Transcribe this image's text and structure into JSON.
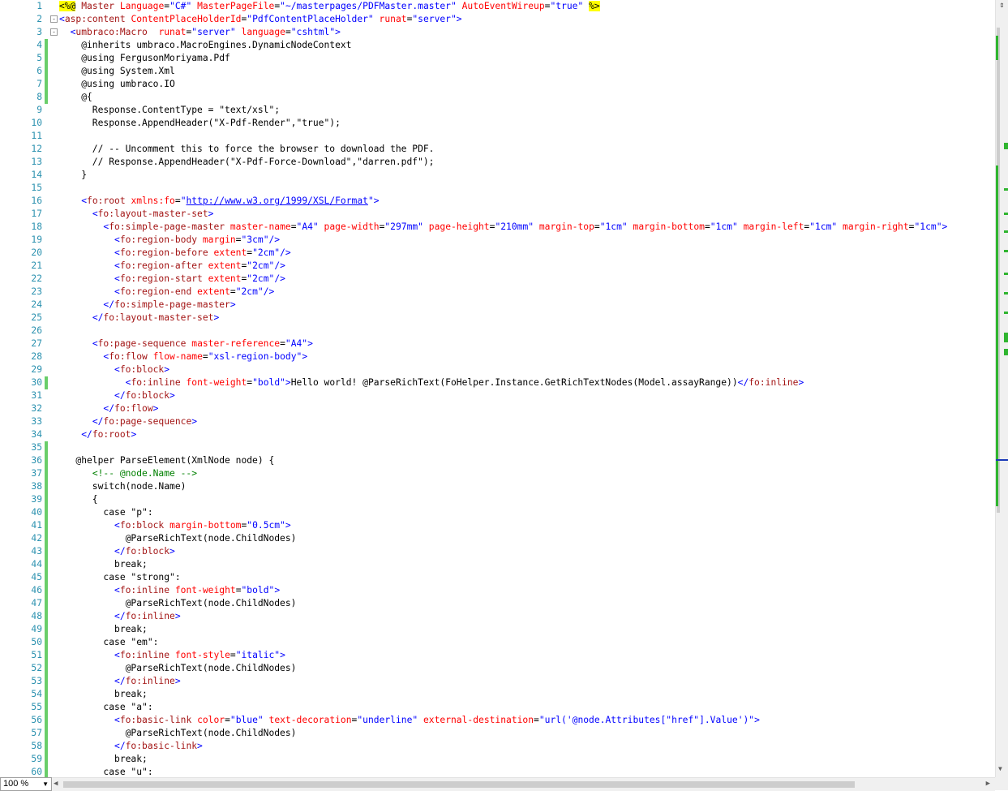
{
  "editor": {
    "lines": [
      {
        "n": "1",
        "html": "<span class=\"hl\">&lt;%@</span> <span class=\"t\">Master</span> <span class=\"a\">Language</span>=<span class=\"v\">\"C#\"</span> <span class=\"a\">MasterPageFile</span>=<span class=\"v\">\"~/masterpages/PDFMaster.master\"</span> <span class=\"a\">AutoEventWireup</span>=<span class=\"v\">\"true\"</span> <span class=\"hl\">%&gt;</span>"
      },
      {
        "n": "2",
        "html": "<span class=\"p\">&lt;</span><span class=\"t\">asp:content</span> <span class=\"a\">ContentPlaceHolderId</span>=<span class=\"v\">\"PdfContentPlaceHolder\"</span> <span class=\"a\">runat</span>=<span class=\"v\">\"server\"</span><span class=\"p\">&gt;</span>",
        "fold": "-"
      },
      {
        "n": "3",
        "html": "  <span class=\"p\">&lt;</span><span class=\"t\">umbraco:Macro</span>  <span class=\"a\">runat</span>=<span class=\"v\">\"server\"</span> <span class=\"a\">language</span>=<span class=\"v\">\"cshtml\"</span><span class=\"p\">&gt;</span>",
        "fold": "-"
      },
      {
        "n": "4",
        "html": "    @inherits umbraco.MacroEngines.DynamicNodeContext",
        "chg": true
      },
      {
        "n": "5",
        "html": "    @using FergusonMoriyama.Pdf",
        "chg": true
      },
      {
        "n": "6",
        "html": "    @using System.Xml",
        "chg": true
      },
      {
        "n": "7",
        "html": "    @using umbraco.IO",
        "chg": true
      },
      {
        "n": "8",
        "html": "    @{",
        "chg": true
      },
      {
        "n": "9",
        "html": "      Response.ContentType = \"text/xsl\";"
      },
      {
        "n": "10",
        "html": "      Response.AppendHeader(\"X-Pdf-Render\",\"true\");"
      },
      {
        "n": "11",
        "html": ""
      },
      {
        "n": "12",
        "html": "      // -- Uncomment this to force the browser to download the PDF."
      },
      {
        "n": "13",
        "html": "      // Response.AppendHeader(\"X-Pdf-Force-Download\",\"darren.pdf\");"
      },
      {
        "n": "14",
        "html": "    }"
      },
      {
        "n": "15",
        "html": ""
      },
      {
        "n": "16",
        "html": "    <span class=\"p\">&lt;</span><span class=\"t\">fo:root</span> <span class=\"a\">xmlns:fo</span>=<span class=\"v\">\"</span><span class=\"u\">http://www.w3.org/1999/XSL/Format</span><span class=\"v\">\"</span><span class=\"p\">&gt;</span>"
      },
      {
        "n": "17",
        "html": "      <span class=\"p\">&lt;</span><span class=\"t\">fo:layout-master-set</span><span class=\"p\">&gt;</span>"
      },
      {
        "n": "18",
        "html": "        <span class=\"p\">&lt;</span><span class=\"t\">fo:simple-page-master</span> <span class=\"a\">master-name</span>=<span class=\"v\">\"A4\"</span> <span class=\"a\">page-width</span>=<span class=\"v\">\"297mm\"</span> <span class=\"a\">page-height</span>=<span class=\"v\">\"210mm\"</span> <span class=\"a\">margin-top</span>=<span class=\"v\">\"1cm\"</span> <span class=\"a\">margin-bottom</span>=<span class=\"v\">\"1cm\"</span> <span class=\"a\">margin-left</span>=<span class=\"v\">\"1cm\"</span> <span class=\"a\">margin-right</span>=<span class=\"v\">\"1cm\"</span><span class=\"p\">&gt;</span>"
      },
      {
        "n": "19",
        "html": "          <span class=\"p\">&lt;</span><span class=\"t\">fo:region-body</span> <span class=\"a\">margin</span>=<span class=\"v\">\"3cm\"</span><span class=\"p\">/&gt;</span>"
      },
      {
        "n": "20",
        "html": "          <span class=\"p\">&lt;</span><span class=\"t\">fo:region-before</span> <span class=\"a\">extent</span>=<span class=\"v\">\"2cm\"</span><span class=\"p\">/&gt;</span>"
      },
      {
        "n": "21",
        "html": "          <span class=\"p\">&lt;</span><span class=\"t\">fo:region-after</span> <span class=\"a\">extent</span>=<span class=\"v\">\"2cm\"</span><span class=\"p\">/&gt;</span>"
      },
      {
        "n": "22",
        "html": "          <span class=\"p\">&lt;</span><span class=\"t\">fo:region-start</span> <span class=\"a\">extent</span>=<span class=\"v\">\"2cm\"</span><span class=\"p\">/&gt;</span>"
      },
      {
        "n": "23",
        "html": "          <span class=\"p\">&lt;</span><span class=\"t\">fo:region-end</span> <span class=\"a\">extent</span>=<span class=\"v\">\"2cm\"</span><span class=\"p\">/&gt;</span>"
      },
      {
        "n": "24",
        "html": "        <span class=\"p\">&lt;/</span><span class=\"t\">fo:simple-page-master</span><span class=\"p\">&gt;</span>"
      },
      {
        "n": "25",
        "html": "      <span class=\"p\">&lt;/</span><span class=\"t\">fo:layout-master-set</span><span class=\"p\">&gt;</span>"
      },
      {
        "n": "26",
        "html": ""
      },
      {
        "n": "27",
        "html": "      <span class=\"p\">&lt;</span><span class=\"t\">fo:page-sequence</span> <span class=\"a\">master-reference</span>=<span class=\"v\">\"A4\"</span><span class=\"p\">&gt;</span>"
      },
      {
        "n": "28",
        "html": "        <span class=\"p\">&lt;</span><span class=\"t\">fo:flow</span> <span class=\"a\">flow-name</span>=<span class=\"v\">\"xsl-region-body\"</span><span class=\"p\">&gt;</span>"
      },
      {
        "n": "29",
        "html": "          <span class=\"p\">&lt;</span><span class=\"t\">fo:block</span><span class=\"p\">&gt;</span>"
      },
      {
        "n": "30",
        "html": "            <span class=\"p\">&lt;</span><span class=\"t\">fo:inline</span> <span class=\"a\">font-weight</span>=<span class=\"v\">\"bold\"</span><span class=\"p\">&gt;</span>Hello world! @ParseRichText(FoHelper.Instance.GetRichTextNodes(Model.assayRange))<span class=\"p\">&lt;/</span><span class=\"t\">fo:inline</span><span class=\"p\">&gt;</span>",
        "chg": true
      },
      {
        "n": "31",
        "html": "          <span class=\"p\">&lt;/</span><span class=\"t\">fo:block</span><span class=\"p\">&gt;</span>"
      },
      {
        "n": "32",
        "html": "        <span class=\"p\">&lt;/</span><span class=\"t\">fo:flow</span><span class=\"p\">&gt;</span>"
      },
      {
        "n": "33",
        "html": "      <span class=\"p\">&lt;/</span><span class=\"t\">fo:page-sequence</span><span class=\"p\">&gt;</span>"
      },
      {
        "n": "34",
        "html": "    <span class=\"p\">&lt;/</span><span class=\"t\">fo:root</span><span class=\"p\">&gt;</span>"
      },
      {
        "n": "35",
        "html": "",
        "chg": true
      },
      {
        "n": "36",
        "html": "   @helper ParseElement(XmlNode node) {",
        "chg": true
      },
      {
        "n": "37",
        "html": "      <span class=\"c\">&lt;!-- @node.Name --&gt;</span>",
        "chg": true
      },
      {
        "n": "38",
        "html": "      switch(node.Name)",
        "chg": true
      },
      {
        "n": "39",
        "html": "      {",
        "chg": true
      },
      {
        "n": "40",
        "html": "        case \"p\":",
        "chg": true
      },
      {
        "n": "41",
        "html": "          <span class=\"p\">&lt;</span><span class=\"t\">fo:block</span> <span class=\"a\">margin-bottom</span>=<span class=\"v\">\"0.5cm\"</span><span class=\"p\">&gt;</span>",
        "chg": true
      },
      {
        "n": "42",
        "html": "            @ParseRichText(node.ChildNodes)",
        "chg": true
      },
      {
        "n": "43",
        "html": "          <span class=\"p\">&lt;/</span><span class=\"t\">fo:block</span><span class=\"p\">&gt;</span>",
        "chg": true
      },
      {
        "n": "44",
        "html": "          break;",
        "chg": true
      },
      {
        "n": "45",
        "html": "        case \"strong\":",
        "chg": true
      },
      {
        "n": "46",
        "html": "          <span class=\"p\">&lt;</span><span class=\"t\">fo:inline</span> <span class=\"a\">font-weight</span>=<span class=\"v\">\"bold\"</span><span class=\"p\">&gt;</span>",
        "chg": true
      },
      {
        "n": "47",
        "html": "            @ParseRichText(node.ChildNodes)",
        "chg": true
      },
      {
        "n": "48",
        "html": "          <span class=\"p\">&lt;/</span><span class=\"t\">fo:inline</span><span class=\"p\">&gt;</span>",
        "chg": true
      },
      {
        "n": "49",
        "html": "          break;",
        "chg": true
      },
      {
        "n": "50",
        "html": "        case \"em\":",
        "chg": true
      },
      {
        "n": "51",
        "html": "          <span class=\"p\">&lt;</span><span class=\"t\">fo:inline</span> <span class=\"a\">font-style</span>=<span class=\"v\">\"italic\"</span><span class=\"p\">&gt;</span>",
        "chg": true
      },
      {
        "n": "52",
        "html": "            @ParseRichText(node.ChildNodes)",
        "chg": true
      },
      {
        "n": "53",
        "html": "          <span class=\"p\">&lt;/</span><span class=\"t\">fo:inline</span><span class=\"p\">&gt;</span>",
        "chg": true
      },
      {
        "n": "54",
        "html": "          break;",
        "chg": true
      },
      {
        "n": "55",
        "html": "        case \"a\":",
        "chg": true
      },
      {
        "n": "56",
        "html": "          <span class=\"p\">&lt;</span><span class=\"t\">fo:basic-link</span> <span class=\"a\">color</span>=<span class=\"v\">\"blue\"</span> <span class=\"a\">text-decoration</span>=<span class=\"v\">\"underline\"</span> <span class=\"a\">external-destination</span>=<span class=\"v\">\"url('@node.Attributes[\"href\"].Value')\"</span><span class=\"p\">&gt;</span>",
        "chg": true
      },
      {
        "n": "57",
        "html": "            @ParseRichText(node.ChildNodes)",
        "chg": true
      },
      {
        "n": "58",
        "html": "          <span class=\"p\">&lt;/</span><span class=\"t\">fo:basic-link</span><span class=\"p\">&gt;</span>",
        "chg": true
      },
      {
        "n": "59",
        "html": "          break;",
        "chg": true
      },
      {
        "n": "60",
        "html": "        case \"u\":",
        "chg": true
      }
    ]
  },
  "status": {
    "zoom": "100 %"
  },
  "colors": {
    "line_number": "#2b91af",
    "tag": "#a31515",
    "attribute": "#ff0000",
    "value": "#0000ff",
    "comment": "#008000",
    "change_marker": "#6ace6a"
  },
  "icons": {
    "split": "split-icon",
    "scroll_up": "scroll-up-arrow-icon",
    "scroll_down": "scroll-down-arrow-icon",
    "scroll_left": "scroll-left-arrow-icon",
    "scroll_right": "scroll-right-arrow-icon",
    "zoom_dropdown": "chevron-down-icon"
  }
}
